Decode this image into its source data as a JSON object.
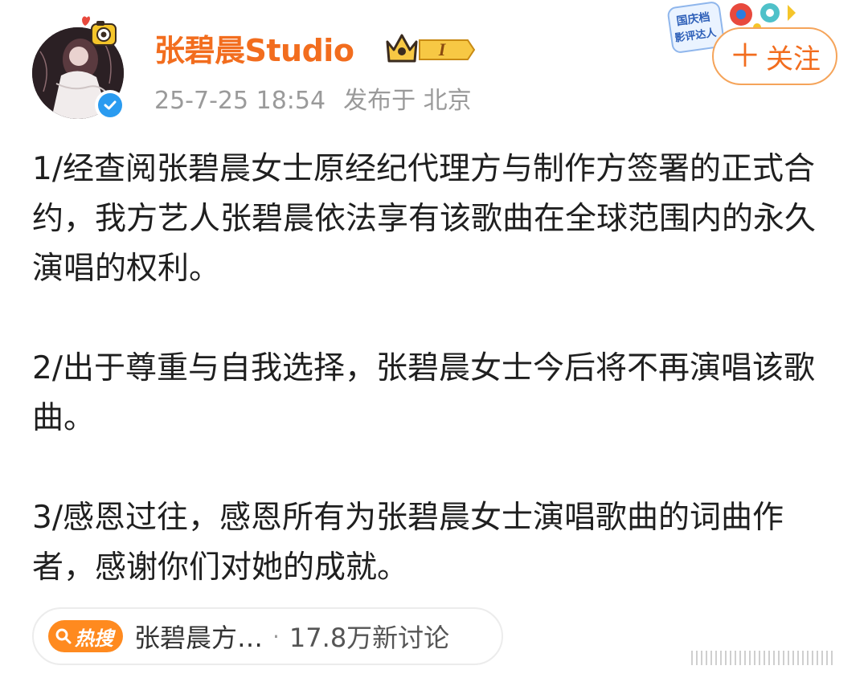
{
  "header": {
    "username": "张碧晨Studio",
    "rank_badge": "I",
    "timestamp": "25-7-25 18:54",
    "location": "发布于 北京",
    "follow_label": "关注",
    "festival_badge_line1": "国庆档",
    "festival_badge_line2": "影评达人"
  },
  "post": {
    "paragraphs": [
      "1/经查阅张碧晨女士原经纪代理方与制作方签署的正式合约，我方艺人张碧晨依法享有该歌曲在全球范围内的永久演唱的权利。",
      "2/出于尊重与自我选择，张碧晨女士今后将不再演唱该歌曲。",
      "3/感恩过往，感恩所有为张碧晨女士演唱歌曲的词曲作者，感谢你们对她的成就。"
    ]
  },
  "hot_search": {
    "tag_label": "热搜",
    "topic": "张碧晨方…",
    "discussion_count": "17.8万新讨论"
  },
  "colors": {
    "accent": "#f26d1e",
    "follow_border": "#f5a45a",
    "hot_tag_bg": "#ff8a1f",
    "verified": "#2a9bf0",
    "meta_text": "#9a9a9a"
  }
}
